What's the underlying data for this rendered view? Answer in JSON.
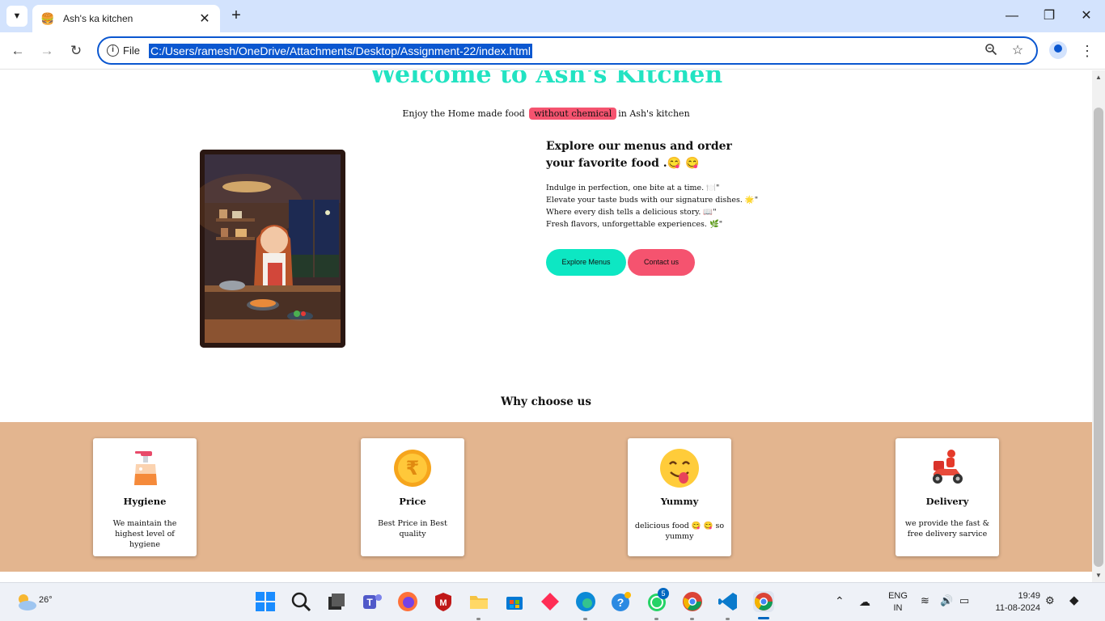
{
  "browser": {
    "tab_title": "Ash's ka kitchen",
    "scheme_label": "File",
    "url": "C:/Users/ramesh/OneDrive/Attachments/Desktop/Assignment-22/index.html"
  },
  "page": {
    "title": "Welcome to Ash's Kitchen",
    "tagline_before": "Enjoy the Home made food",
    "tagline_highlight": "without chemical",
    "tagline_after": "in Ash's kitchen",
    "explore_heading": "Explore our menus and order your favorite food .😋 😋",
    "taglines": [
      "Indulge in perfection, one bite at a time. 🍽️\"",
      "Elevate your taste buds with our signature dishes. 🌟\"",
      "Where every dish tells a delicious story. 📖\"",
      "Fresh flavors, unforgettable experiences. 🌿\""
    ],
    "explore_button": "Explore Menus",
    "contact_button": "Contact us",
    "why_heading": "Why choose us",
    "features": [
      {
        "title": "Hygiene",
        "text": "We maintain the highest level of hygiene",
        "icon": "soap-dispenser-icon"
      },
      {
        "title": "Price",
        "text": "Best Price in Best quality",
        "icon": "rupee-coin-icon"
      },
      {
        "title": "Yummy",
        "text": "delicious food 😋 😋 so yummy",
        "icon": "yummy-face-icon"
      },
      {
        "title": "Delivery",
        "text": "we provide the fast & free delivery sarvice",
        "icon": "delivery-scooter-icon"
      }
    ]
  },
  "taskbar": {
    "temperature": "26°",
    "language_top": "ENG",
    "language_bottom": "IN",
    "time": "19:49",
    "date": "11-08-2024",
    "whatsapp_badge": "5"
  },
  "colors": {
    "accent_teal": "#0de7c3",
    "accent_pink": "#f5536f",
    "feature_band": "#e3b58f",
    "omnibox_border": "#0b57d0"
  }
}
